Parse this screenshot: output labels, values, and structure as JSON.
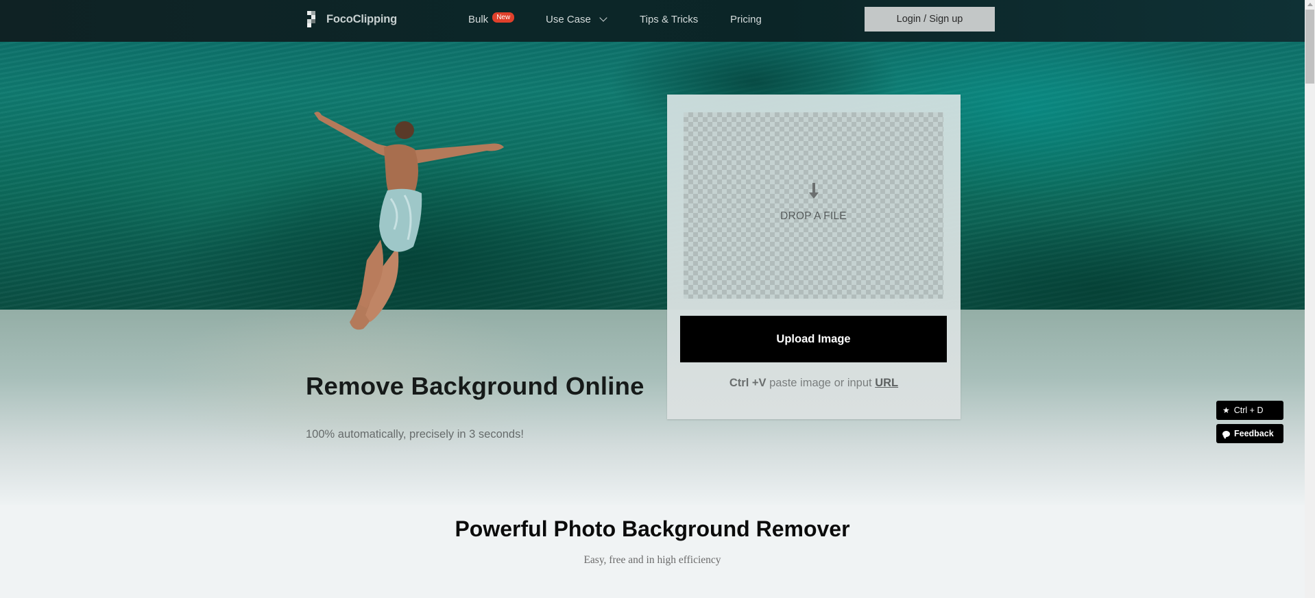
{
  "nav": {
    "logo_text": "FocoClipping",
    "items": [
      {
        "label": "Bulk",
        "badge": "New"
      },
      {
        "label": "Use Case",
        "has_dropdown": true
      },
      {
        "label": "Tips & Tricks"
      },
      {
        "label": "Pricing"
      }
    ],
    "login_label": "Login / Sign up"
  },
  "hero": {
    "title": "Remove Background Online",
    "subtitle": "100% automatically, precisely in 3 seconds!"
  },
  "upload": {
    "drop_text": "DROP A FILE",
    "button_label": "Upload Image",
    "hint_shortcut": "Ctrl +V",
    "hint_text": " paste image or input ",
    "hint_link": "URL"
  },
  "section": {
    "title": "Powerful Photo Background Remover",
    "subtitle": "Easy, free and in high efficiency"
  },
  "floating": {
    "bookmark_label": "Ctrl + D",
    "feedback_label": "Feedback"
  },
  "colors": {
    "nav_bg": "#0c2628",
    "badge": "#e0402b",
    "primary_button": "#000000",
    "login_button": "#c3c7c7"
  }
}
